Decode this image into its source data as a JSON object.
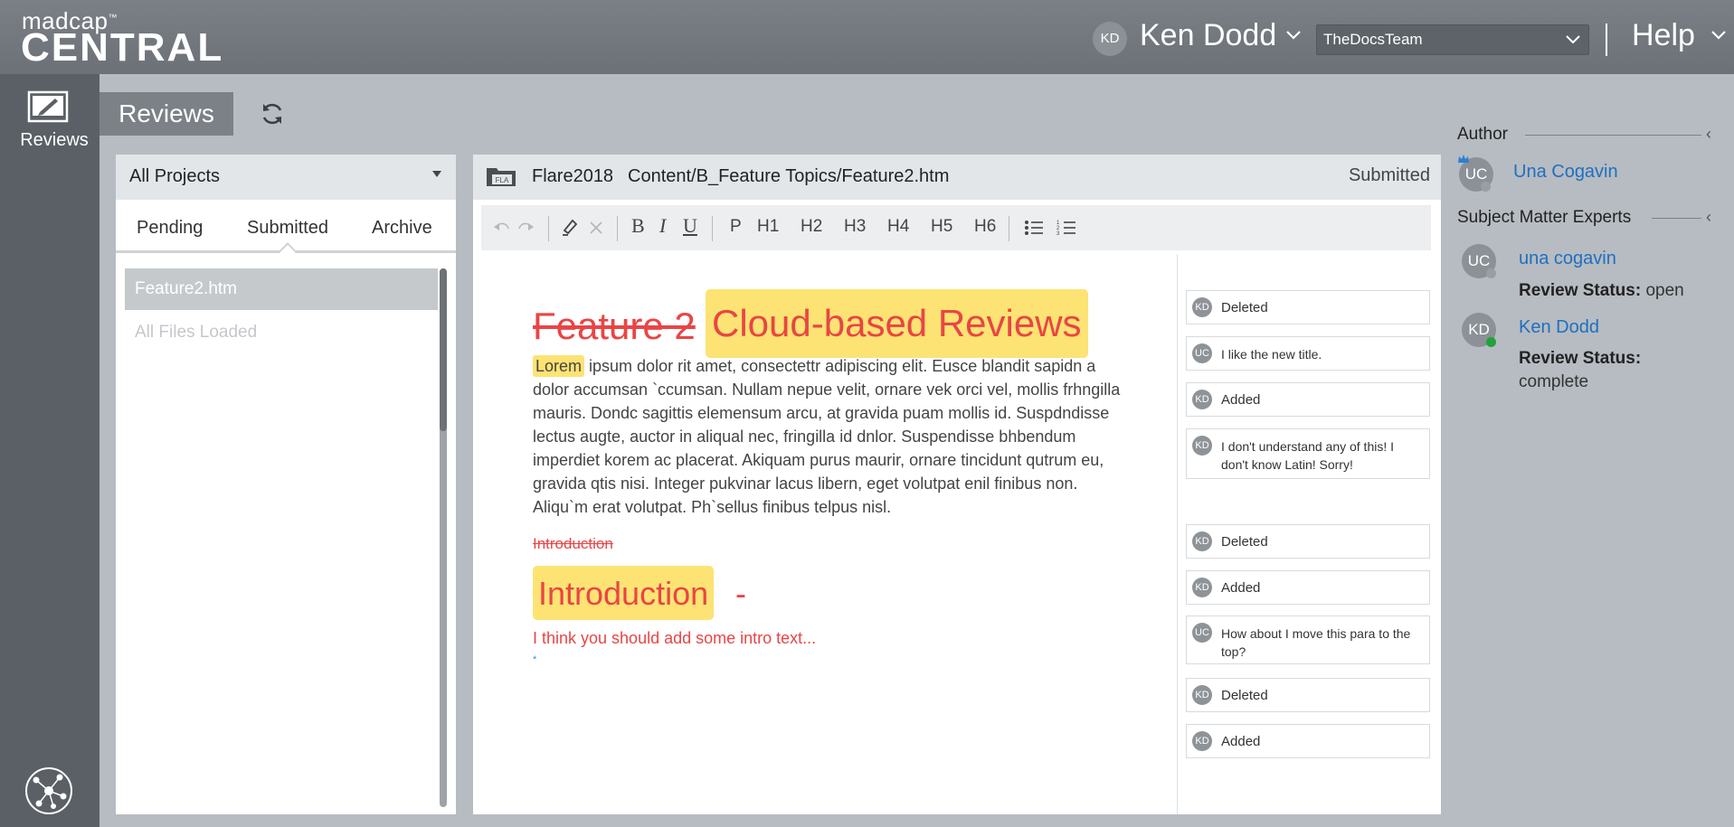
{
  "header": {
    "logo_top": "madcap",
    "logo_tm": "™",
    "logo_bottom": "CENTRAL",
    "user_initials": "KD",
    "user_name": "Ken Dodd",
    "team": "TheDocsTeam",
    "help": "Help"
  },
  "rail": {
    "reviews_label": "Reviews"
  },
  "page": {
    "tab_label": "Reviews"
  },
  "project_list": {
    "project_select": "All Projects",
    "tabs": [
      "Pending",
      "Submitted",
      "Archive"
    ],
    "active_tab": "Submitted",
    "files": [
      "Feature2.htm"
    ],
    "loaded_note": "All Files Loaded"
  },
  "document": {
    "project_icon_label": "FLA",
    "project": "Flare2018",
    "path": "Content/B_Feature Topics/Feature2.htm",
    "status": "Submitted",
    "toolbar": {
      "bold": "B",
      "italic": "I",
      "underline": "U",
      "paragraph": "P",
      "h1": "H1",
      "h2": "H2",
      "h3": "H3",
      "h4": "H4",
      "h5": "H5",
      "h6": "H6"
    },
    "title_deleted": "Feature 2",
    "title_added": "Cloud-based Reviews",
    "para_highlight": "Lorem",
    "para_text": " ipsum dolor rit amet, consectettr adipiscing elit. Eusce blandit sapidn a dolor accumsan `ccumsan. Nullam nepue velit, ornare vek orci vel, mollis frhngilla mauris. Dondc sagittis elemensum arcu, at gravida puam mollis id. Suspdndisse lectus augte, auctor in aliqual nec, fringilla id dnlor. Suspendisse bhbendum imperdiet korem ac placerat. Akiquam purus maurir, ornare tincidunt qutrum eu, gravida qtis nisi. Integer pukvinar lacus libern, eget volutpat enil finibus non. Aliqu`m erat volutpat. Ph`sellus finibus telpus nisl.",
    "intro_deleted": "Introduction",
    "intro_added": "Introduction",
    "intro_dash": "-",
    "intro_comment_text": "I think you should add some intro text...",
    "marker": "*"
  },
  "comments": [
    {
      "initials": "KD",
      "text": "Deleted"
    },
    {
      "initials": "UC",
      "text": "I like the new title."
    },
    {
      "initials": "KD",
      "text": "Added"
    },
    {
      "initials": "KD",
      "text": "I don't understand any of this! I don't know Latin! Sorry!"
    },
    {
      "initials": "KD",
      "text": "Deleted"
    },
    {
      "initials": "KD",
      "text": "Added"
    },
    {
      "initials": "UC",
      "text": "How about I move this para to the top?"
    },
    {
      "initials": "KD",
      "text": "Deleted"
    },
    {
      "initials": "KD",
      "text": "Added"
    }
  ],
  "side": {
    "author_label": "Author",
    "author_initials": "UC",
    "author_name": "Una Cogavin",
    "sme_label": "Subject Matter Experts",
    "experts": [
      {
        "initials": "UC",
        "name": "una cogavin",
        "status_label": "Review Status:",
        "status": "open",
        "status_color": "#9a9ea3"
      },
      {
        "initials": "KD",
        "name": "Ken Dodd",
        "status_label": "Review Status:",
        "status": "complete",
        "status_color": "#1fa33a"
      }
    ]
  },
  "colors": {
    "added_highlight": "#fce373",
    "change_red": "#e94545",
    "link_blue": "#1f6fbf"
  }
}
